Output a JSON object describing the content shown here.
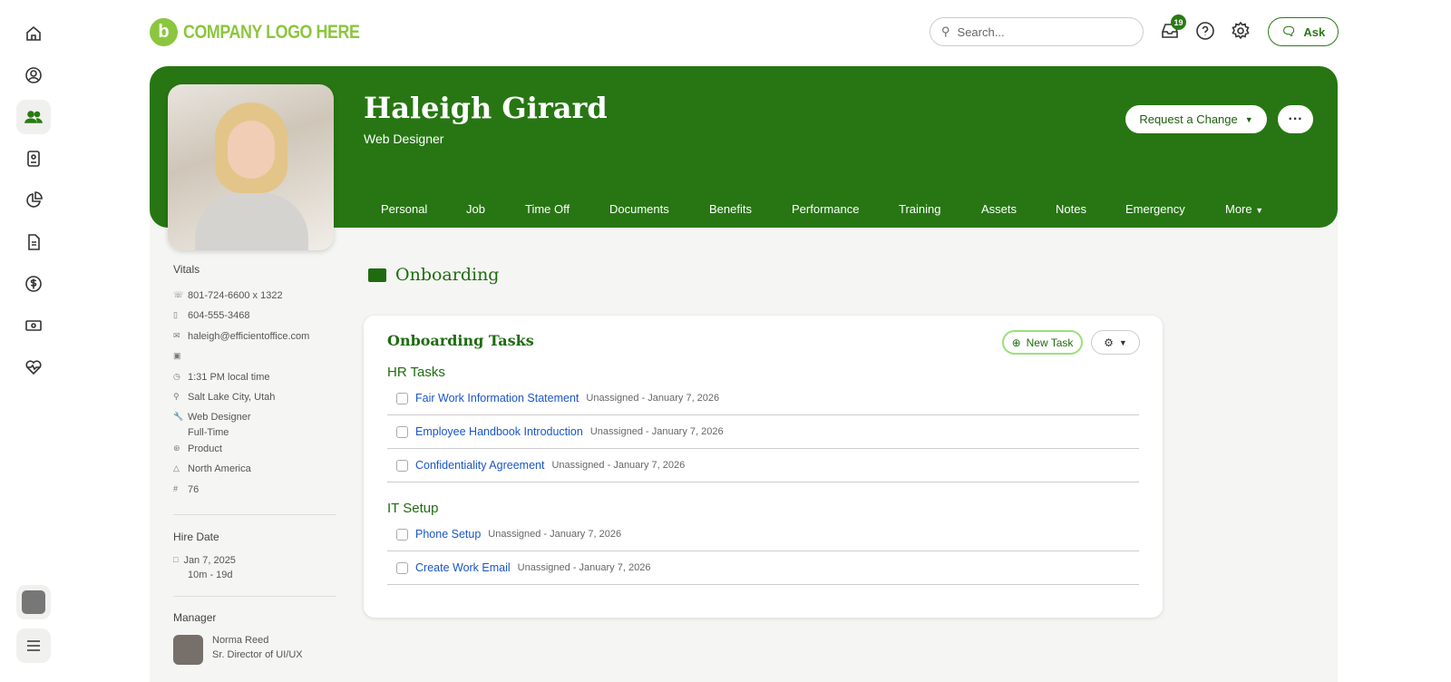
{
  "logo": {
    "text": "COMPANY LOGO HERE"
  },
  "nav": {
    "items": [
      "home",
      "person",
      "people",
      "badge",
      "reports",
      "document",
      "payroll",
      "money",
      "benefits"
    ]
  },
  "topbar": {
    "search_placeholder": "Search...",
    "inbox_count": "19",
    "ask_label": "Ask"
  },
  "profile": {
    "name": "Haleigh Girard",
    "title": "Web Designer",
    "request_label": "Request a Change",
    "more_label": "···"
  },
  "tabs": [
    "Personal",
    "Job",
    "Time Off",
    "Documents",
    "Benefits",
    "Performance",
    "Training",
    "Assets",
    "Notes",
    "Emergency",
    "More"
  ],
  "vitals": {
    "heading": "Vitals",
    "work_phone": "801-724-6600 x 1322",
    "mobile": "604-555-3468",
    "email": "haleigh@efficientoffice.com",
    "local_time": "1:31 PM local time",
    "location": "Salt Lake City, Utah",
    "job": "Web Designer",
    "employment": "Full-Time",
    "department": "Product",
    "region": "North America",
    "employee_number": "76"
  },
  "hire": {
    "heading": "Hire Date",
    "date": "Jan 7, 2025",
    "tenure": "10m - 19d"
  },
  "manager": {
    "heading": "Manager",
    "name": "Norma Reed",
    "title": "Sr. Director of UI/UX"
  },
  "page": {
    "title": "Onboarding"
  },
  "card": {
    "title": "Onboarding Tasks",
    "new_task": "New Task",
    "groups": [
      {
        "name": "HR Tasks",
        "tasks": [
          {
            "name": "Fair Work Information Statement",
            "meta": "Unassigned - January 7, 2026"
          },
          {
            "name": "Employee Handbook Introduction",
            "meta": "Unassigned - January 7, 2026"
          },
          {
            "name": "Confidentiality Agreement",
            "meta": "Unassigned - January 7, 2026"
          }
        ]
      },
      {
        "name": "IT Setup",
        "tasks": [
          {
            "name": "Phone Setup",
            "meta": "Unassigned - January 7, 2026"
          },
          {
            "name": "Create Work Email",
            "meta": "Unassigned - January 7, 2026"
          }
        ]
      }
    ]
  },
  "colors": {
    "brand": "#277613",
    "logo": "#8cc63f",
    "link": "#1a56c8"
  }
}
